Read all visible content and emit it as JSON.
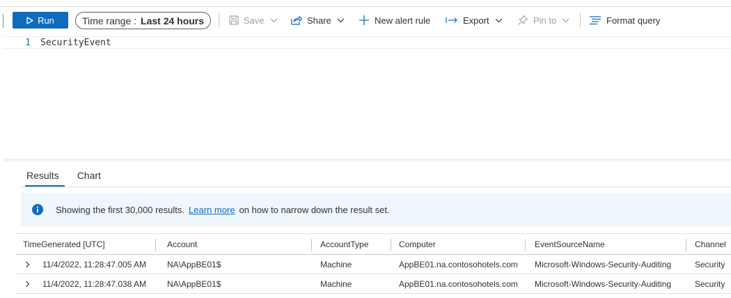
{
  "toolbar": {
    "run_label": "Run",
    "time_range_prefix": "Time range :",
    "time_range_value": "Last 24 hours",
    "save_label": "Save",
    "share_label": "Share",
    "new_alert_label": "New alert rule",
    "export_label": "Export",
    "pin_label": "Pin to",
    "format_label": "Format query"
  },
  "editor": {
    "line_number": "1",
    "code": "SecurityEvent"
  },
  "results": {
    "tabs": [
      "Results",
      "Chart"
    ],
    "active_tab": "Results",
    "info": {
      "text_before": "Showing the first 30,000 results.",
      "link": "Learn more",
      "text_after": "on how to narrow down the result set."
    },
    "columns": [
      "TimeGenerated [UTC]",
      "Account",
      "AccountType",
      "Computer",
      "EventSourceName",
      "Channel"
    ],
    "rows": [
      [
        "11/4/2022, 11:28:47.005 AM",
        "NA\\AppBE01$",
        "Machine",
        "AppBE01.na.contosohotels.com",
        "Microsoft-Windows-Security-Auditing",
        "Security"
      ],
      [
        "11/4/2022, 11:28:47.038 AM",
        "NA\\AppBE01$",
        "Machine",
        "AppBE01.na.contosohotels.com",
        "Microsoft-Windows-Security-Auditing",
        "Security"
      ]
    ]
  },
  "colors": {
    "accent": "#0f6cbd",
    "info_bg": "#eff6fc"
  },
  "icons": {
    "run": "play-icon",
    "save": "save-icon",
    "share": "share-icon",
    "new_alert": "plus-icon",
    "export": "export-arrow-icon",
    "pin": "pin-icon",
    "format": "format-lines-icon",
    "info": "info-icon",
    "expand": "chevron-right-icon"
  }
}
